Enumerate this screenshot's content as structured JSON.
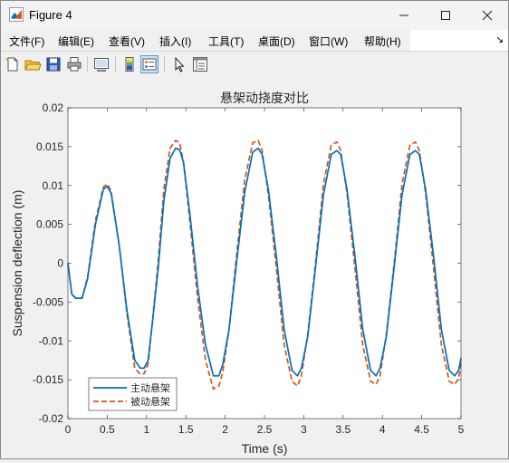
{
  "window": {
    "title": "Figure 4"
  },
  "menu": {
    "items": [
      "文件(F)",
      "编辑(E)",
      "查看(V)",
      "插入(I)",
      "工具(T)",
      "桌面(D)",
      "窗口(W)",
      "帮助(H)"
    ],
    "overflow": "↘"
  },
  "toolbar": {
    "buttons": [
      "new-figure-icon",
      "open-file-icon",
      "save-icon",
      "print-icon",
      "link-plot-icon",
      "insert-colorbar-icon",
      "insert-legend-icon",
      "pointer-icon",
      "property-inspector-icon"
    ]
  },
  "colors": {
    "series1": "#0072BD",
    "series2": "#D95319",
    "plot_bg": "#ffffff",
    "figure_bg": "#f0f0f0"
  },
  "chart_data": {
    "type": "line",
    "title": "悬架动挠度对比",
    "xlabel": "Time (s)",
    "ylabel": "Suspension deflection (m)",
    "xlim": [
      0,
      5
    ],
    "ylim": [
      -0.02,
      0.02
    ],
    "xticks": [
      "0",
      "0.5",
      "1",
      "1.5",
      "2",
      "2.5",
      "3",
      "3.5",
      "4",
      "4.5",
      "5"
    ],
    "yticks": [
      "-0.02",
      "-0.015",
      "-0.01",
      "-0.005",
      "0",
      "0.005",
      "0.01",
      "0.015",
      "0.02"
    ],
    "grid": false,
    "legend_position": "bottom-left",
    "series": [
      {
        "name": "主动悬架",
        "style": "solid",
        "x": [
          0,
          0.05,
          0.1,
          0.18,
          0.25,
          0.35,
          0.45,
          0.5,
          0.55,
          0.65,
          0.75,
          0.85,
          0.92,
          0.97,
          1.02,
          1.08,
          1.15,
          1.22,
          1.3,
          1.37,
          1.42,
          1.47,
          1.55,
          1.65,
          1.75,
          1.85,
          1.92,
          1.97,
          2.05,
          2.15,
          2.25,
          2.35,
          2.42,
          2.47,
          2.55,
          2.65,
          2.75,
          2.85,
          2.92,
          2.97,
          3.05,
          3.15,
          3.25,
          3.35,
          3.42,
          3.47,
          3.55,
          3.65,
          3.75,
          3.85,
          3.92,
          3.97,
          4.05,
          4.15,
          4.25,
          4.35,
          4.42,
          4.47,
          4.55,
          4.65,
          4.75,
          4.85,
          4.92,
          4.97,
          5.0
        ],
        "y": [
          0,
          -0.004,
          -0.0045,
          -0.0045,
          -0.002,
          0.005,
          0.0095,
          0.0099,
          0.009,
          0.0025,
          -0.006,
          -0.0125,
          -0.0135,
          -0.0135,
          -0.0125,
          -0.0072,
          -0.0005,
          0.008,
          0.0135,
          0.0148,
          0.0146,
          0.013,
          0.0065,
          -0.003,
          -0.0105,
          -0.0145,
          -0.0145,
          -0.013,
          -0.0085,
          0.0005,
          0.0092,
          0.0143,
          0.0148,
          0.014,
          0.0095,
          0.001,
          -0.0085,
          -0.0138,
          -0.0145,
          -0.0135,
          -0.0095,
          -0.0005,
          0.0088,
          0.014,
          0.0145,
          0.014,
          0.0095,
          0.001,
          -0.0085,
          -0.0138,
          -0.0145,
          -0.0135,
          -0.0095,
          -0.0005,
          0.0088,
          0.014,
          0.0145,
          0.014,
          0.0095,
          0.001,
          -0.0085,
          -0.0138,
          -0.0145,
          -0.0138,
          -0.0122
        ]
      },
      {
        "name": "被动悬架",
        "style": "dashed",
        "x": [
          0,
          0.05,
          0.1,
          0.18,
          0.25,
          0.35,
          0.45,
          0.5,
          0.55,
          0.65,
          0.75,
          0.85,
          0.92,
          0.97,
          1.02,
          1.08,
          1.15,
          1.22,
          1.3,
          1.37,
          1.42,
          1.47,
          1.55,
          1.65,
          1.75,
          1.85,
          1.92,
          1.97,
          2.05,
          2.15,
          2.25,
          2.35,
          2.42,
          2.47,
          2.55,
          2.65,
          2.75,
          2.85,
          2.92,
          2.97,
          3.05,
          3.15,
          3.25,
          3.35,
          3.42,
          3.47,
          3.55,
          3.65,
          3.75,
          3.85,
          3.92,
          3.97,
          4.05,
          4.15,
          4.25,
          4.35,
          4.42,
          4.47,
          4.55,
          4.65,
          4.75,
          4.85,
          4.92,
          4.97,
          5.0
        ],
        "y": [
          0,
          -0.004,
          -0.0045,
          -0.0045,
          -0.0018,
          0.0055,
          0.0098,
          0.0102,
          0.0093,
          0.0025,
          -0.0065,
          -0.0135,
          -0.0143,
          -0.0142,
          -0.013,
          -0.007,
          0.0005,
          0.0095,
          0.0148,
          0.0158,
          0.0155,
          0.013,
          0.0055,
          -0.0045,
          -0.0125,
          -0.0162,
          -0.0158,
          -0.014,
          -0.0085,
          0.0015,
          0.0108,
          0.0155,
          0.0158,
          0.0145,
          0.0088,
          -0.0005,
          -0.0105,
          -0.0152,
          -0.0158,
          -0.0145,
          -0.0092,
          0.0,
          0.0102,
          0.0152,
          0.0156,
          0.0145,
          0.009,
          -0.0005,
          -0.0105,
          -0.0152,
          -0.0156,
          -0.0145,
          -0.0092,
          0.0,
          0.0102,
          0.0152,
          0.0156,
          0.0145,
          0.009,
          -0.0005,
          -0.0105,
          -0.0152,
          -0.0156,
          -0.0148,
          -0.013
        ]
      }
    ]
  }
}
